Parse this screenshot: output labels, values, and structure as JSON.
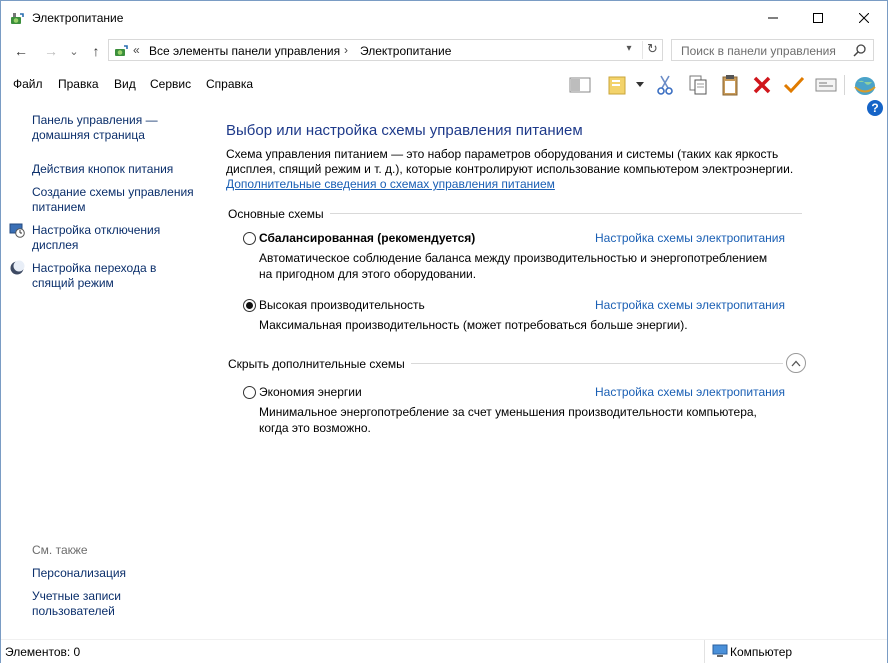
{
  "window": {
    "title": "Электропитание",
    "controls": {
      "minimize": "—",
      "maximize": "☐",
      "close": "✕"
    }
  },
  "address": {
    "back": "←",
    "forward": "→",
    "recent": "⌄",
    "up": "↑",
    "overflow": "«",
    "crumbs": [
      "Все элементы панели управления",
      "Электропитание"
    ],
    "separator": "›",
    "refresh": "↻"
  },
  "search": {
    "placeholder": "Поиск в панели управления"
  },
  "menu": [
    "Файл",
    "Правка",
    "Вид",
    "Сервис",
    "Справка"
  ],
  "toolbar_icons": [
    "layout-pane-icon",
    "folder-view-icon",
    "cut-icon",
    "copy-icon",
    "paste-icon",
    "delete-icon",
    "checkmark-icon",
    "properties-icon",
    "globe-icon"
  ],
  "help": {
    "label": "?"
  },
  "left_nav": {
    "links": [
      {
        "label": "Панель управления —",
        "label2": "домашняя страница"
      },
      {
        "label": "Действия кнопок питания"
      },
      {
        "label": "Создание схемы управления",
        "label2": "питанием"
      },
      {
        "label": "Настройка отключения",
        "label2": "дисплея",
        "icon": "display-clock-icon"
      },
      {
        "label": "Настройка перехода в",
        "label2": "спящий режим",
        "icon": "moon-icon"
      }
    ],
    "see_also": "См. также",
    "see_also_links": [
      {
        "label": "Персонализация"
      },
      {
        "label": "Учетные записи",
        "label2": "пользователей"
      }
    ]
  },
  "main": {
    "heading": "Выбор или настройка схемы управления питанием",
    "intro": "Схема управления питанием — это набор параметров оборудования и системы (таких как яркость дисплея, спящий режим и т. д.), которые контролируют использование компьютером электроэнергии.",
    "intro_link": "Дополнительные сведения о схемах управления питанием",
    "group_basic": "Основные схемы",
    "group_hidden": "Скрыть дополнительные схемы",
    "schemes": [
      {
        "name": "Сбалансированная (рекомендуется)",
        "selected": false,
        "desc": "Автоматическое соблюдение баланса между производительностью и энергопотреблением на пригодном для этого оборудовании.",
        "link": "Настройка схемы электропитания"
      },
      {
        "name": "Высокая производительность",
        "selected": true,
        "desc": "Максимальная производительность (может потребоваться больше энергии).",
        "link": "Настройка схемы электропитания"
      },
      {
        "name": "Экономия энергии",
        "selected": false,
        "desc": "Минимальное энергопотребление за счет уменьшения производительности компьютера, когда это возможно.",
        "link": "Настройка схемы электропитания"
      }
    ]
  },
  "status": {
    "items": "Элементов: 0",
    "zone": "Компьютер"
  },
  "colors": {
    "heading": "#1e3a8a",
    "link": "#1a5fb4",
    "nav_link": "#0b2f6b",
    "delete": "#d0161c",
    "check": "#e07b00"
  }
}
